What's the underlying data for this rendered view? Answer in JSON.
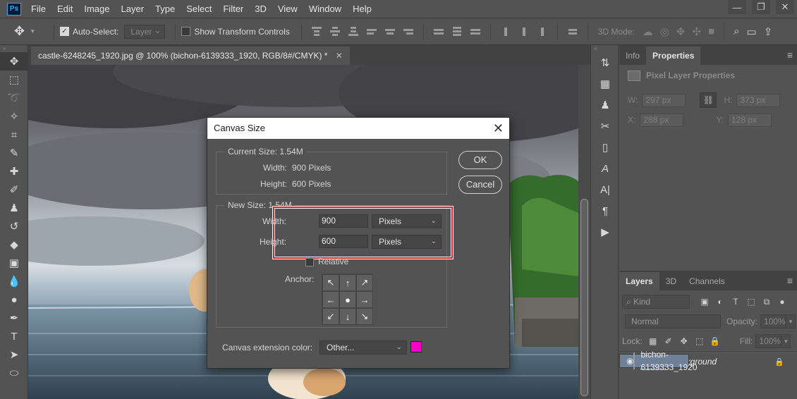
{
  "menu": {
    "logo": "Ps",
    "items": [
      "File",
      "Edit",
      "Image",
      "Layer",
      "Type",
      "Select",
      "Filter",
      "3D",
      "View",
      "Window",
      "Help"
    ]
  },
  "options_bar": {
    "auto_select_label": "Auto-Select:",
    "auto_select_checked": true,
    "layer_dropdown": "Layer",
    "show_transform_label": "Show Transform Controls",
    "mode3d_label": "3D Mode:"
  },
  "document": {
    "tab_title": "castle-6248245_1920.jpg @ 100% (bichon-6139333_1920, RGB/8#/CMYK) *"
  },
  "dialog": {
    "title": "Canvas Size",
    "current_size_label": "Current Size: 1.54M",
    "current_width_label": "Width:",
    "current_width_value": "900 Pixels",
    "current_height_label": "Height:",
    "current_height_value": "600 Pixels",
    "new_size_label": "New Size: 1.54M",
    "width_label": "Width:",
    "width_value": "900",
    "width_unit": "Pixels",
    "height_label": "Height:",
    "height_value": "600",
    "height_unit": "Pixels",
    "relative_label": "Relative",
    "relative_checked": false,
    "anchor_label": "Anchor:",
    "extension_label": "Canvas extension color:",
    "extension_value": "Other...",
    "extension_color": "#ff00cc",
    "ok_label": "OK",
    "cancel_label": "Cancel"
  },
  "properties_panel": {
    "tabs": [
      "Info",
      "Properties"
    ],
    "active_tab": "Properties",
    "header": "Pixel Layer Properties",
    "w_label": "W:",
    "w_value": "297 px",
    "h_label": "H:",
    "h_value": "373 px",
    "x_label": "X:",
    "x_value": "288 px",
    "y_label": "Y:",
    "y_value": "128 px"
  },
  "layers_panel": {
    "tabs": [
      "Layers",
      "3D",
      "Channels"
    ],
    "active_tab": "Layers",
    "kind_label": "Kind",
    "blend_mode": "Normal",
    "opacity_label": "Opacity:",
    "opacity_value": "100%",
    "lock_label": "Lock:",
    "fill_label": "Fill:",
    "fill_value": "100%",
    "layers": [
      {
        "name": "bichon-6139333_1920",
        "selected": true,
        "italic": false,
        "locked": false
      },
      {
        "name": "Background",
        "selected": false,
        "italic": true,
        "locked": true
      }
    ]
  },
  "colors": {
    "highlight": "#d4232f",
    "selected_layer": "#6f8197"
  }
}
